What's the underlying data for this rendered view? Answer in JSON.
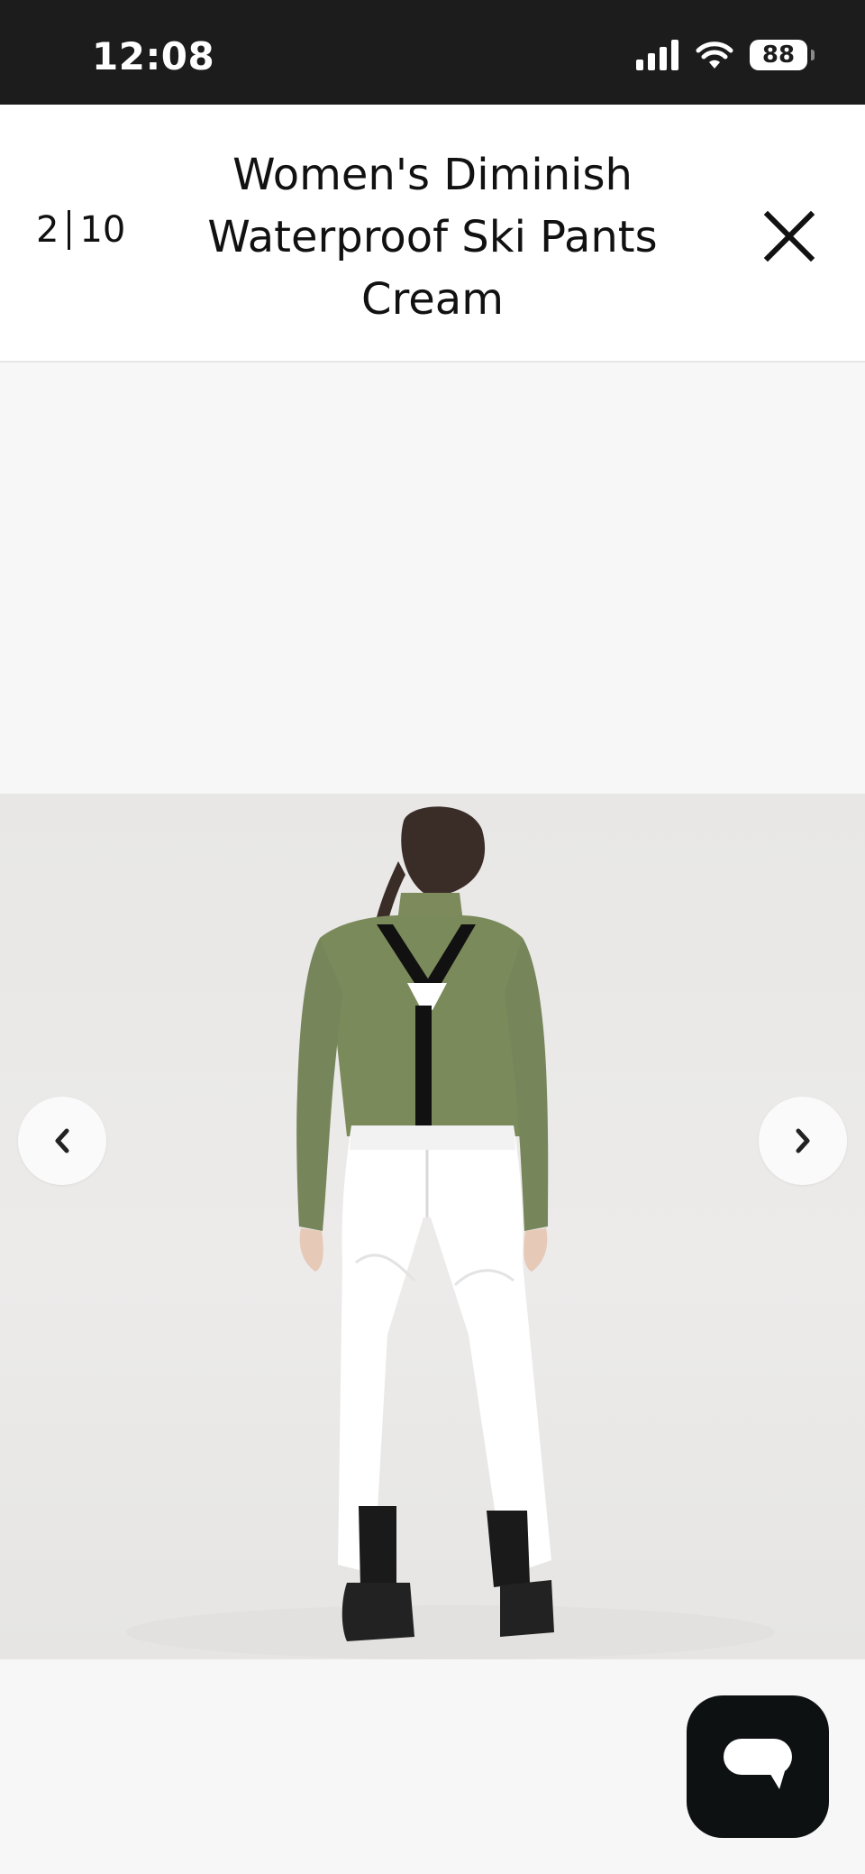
{
  "status_bar": {
    "time": "12:08",
    "battery": "88",
    "icons": [
      "signal-icon",
      "wifi-icon",
      "battery-icon"
    ]
  },
  "header": {
    "counter_current": "2",
    "counter_total": "10",
    "title_lines": [
      "Women's Diminish",
      "Waterproof Ski Pants",
      "Cream"
    ],
    "close_icon": "close-icon"
  },
  "gallery": {
    "image_description_icon": "product-photo",
    "prev_icon": "chevron-left-icon",
    "next_icon": "chevron-right-icon"
  },
  "chat": {
    "icon": "chat-bubble-icon"
  },
  "colors": {
    "status_bar_bg": "#1c1c1c",
    "chat_button_bg": "#0d1112",
    "shirt": "#7b8a5a",
    "pants": "#ffffff"
  }
}
